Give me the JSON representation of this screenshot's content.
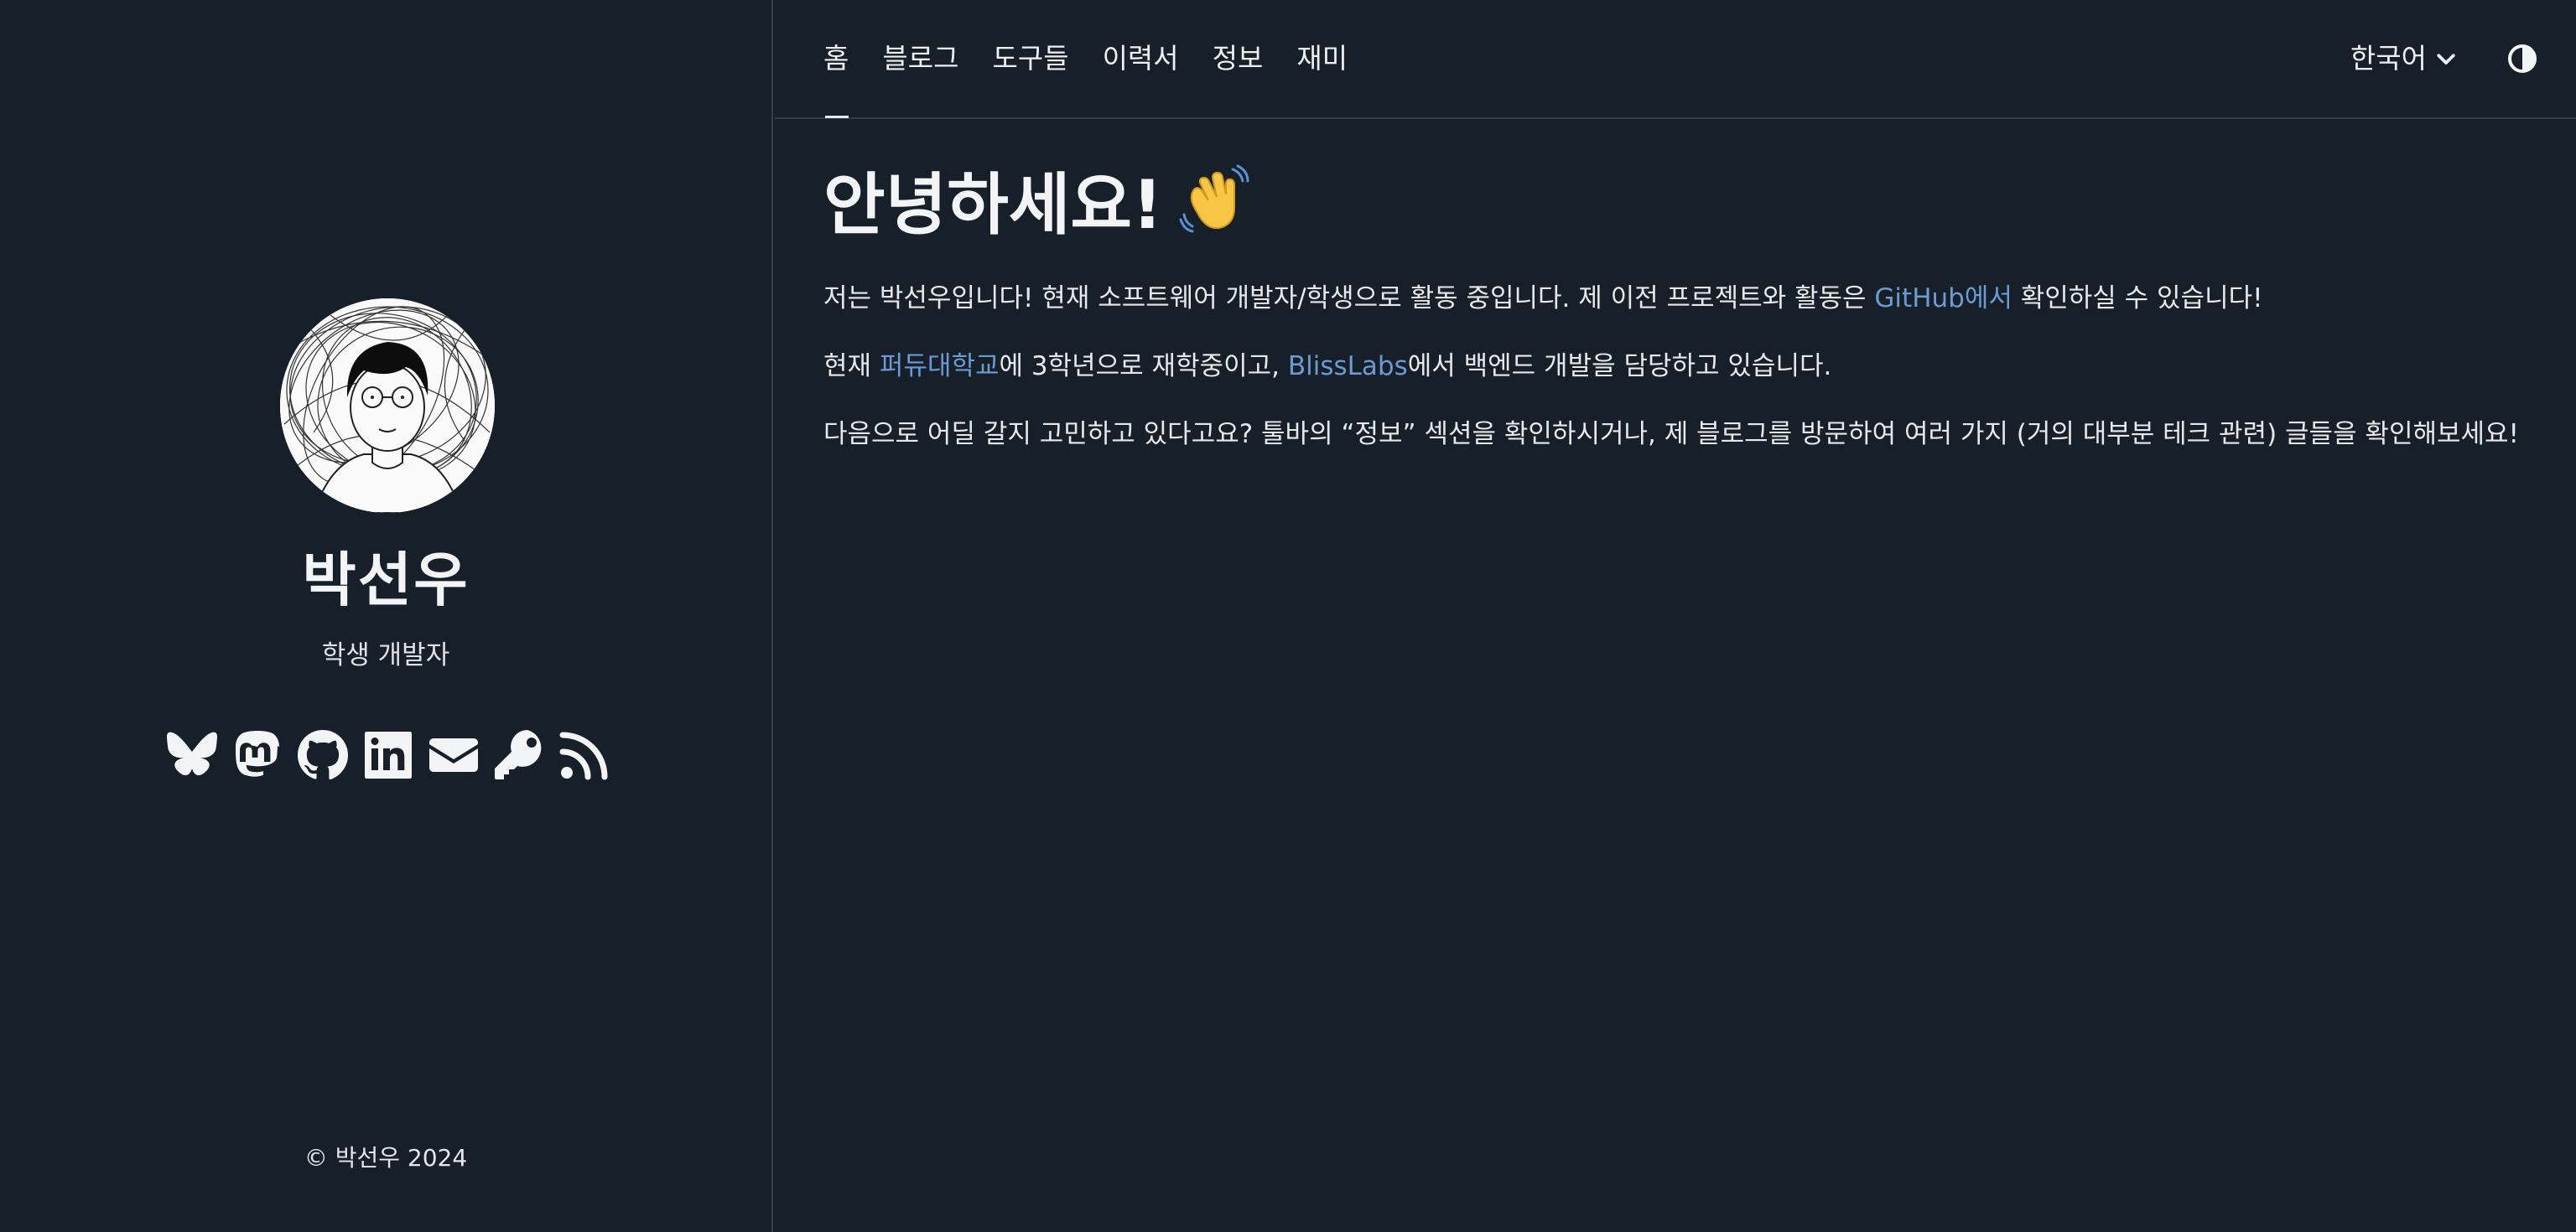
{
  "nav": {
    "links": [
      "홈",
      "블로그",
      "도구들",
      "이력서",
      "정보",
      "재미"
    ],
    "active_index": 0,
    "language": "한국어"
  },
  "profile": {
    "name": "박선우",
    "role": "학생 개발자",
    "socials": [
      "bluesky-icon",
      "mastodon-icon",
      "github-icon",
      "linkedin-icon",
      "email-icon",
      "key-icon",
      "rss-icon"
    ]
  },
  "footer": {
    "copyright": "© 박선우 2024"
  },
  "main": {
    "heading": "안녕하세요!",
    "p1": {
      "before": "저는 박선우입니다! 현재 소프트웨어 개발자/학생으로 활동 중입니다. 제 이전 프로젝트와 활동은 ",
      "link": "GitHub에서",
      "after": " 확인하실 수 있습니다!"
    },
    "p2": {
      "before": "현재 ",
      "link1": "퍼듀대학교",
      "middle": "에 3학년으로 재학중이고, ",
      "link2": "BlissLabs",
      "after": "에서 백엔드 개발을 담당하고 있습니다."
    },
    "p3": "다음으로 어딜 갈지 고민하고 있다고요? 툴바의 “정보” 섹션을 확인하시거나, 제 블로그를 방문하여 여러 가지 (거의 대부분 테크 관련) 글들을 확인해보세요!"
  },
  "colors": {
    "background": "#171f28",
    "border": "#353f49",
    "link": "#6b9bd2",
    "text": "#e8ebee"
  }
}
